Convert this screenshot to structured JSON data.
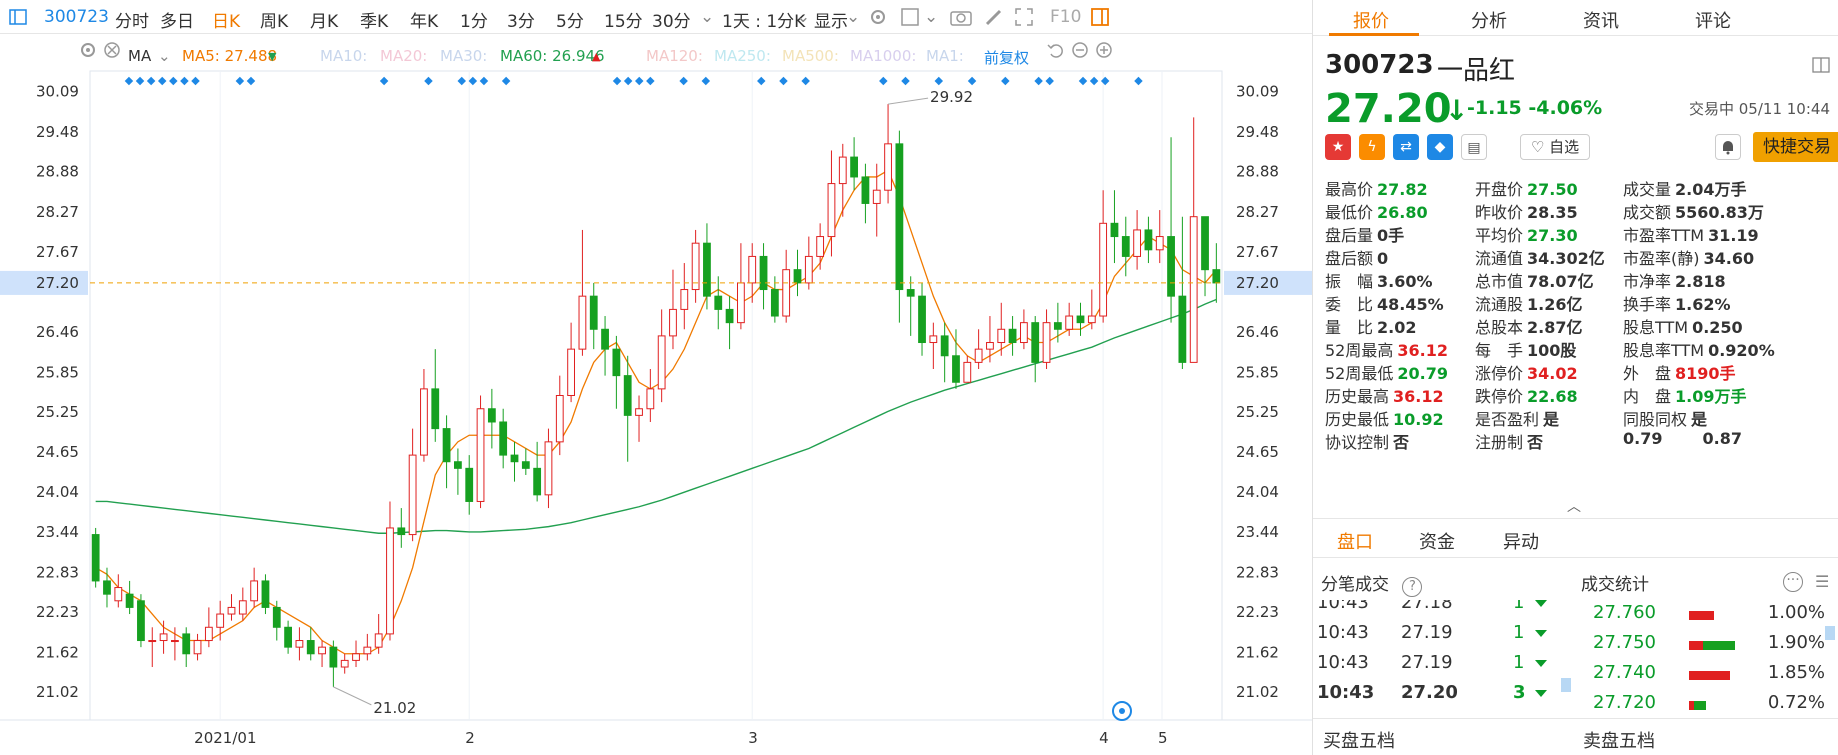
{
  "toolbar": {
    "code": "300723",
    "periods": [
      "分时",
      "多日",
      "日K",
      "周K",
      "月K",
      "季K",
      "年K",
      "1分",
      "3分",
      "5分",
      "15分",
      "30分"
    ],
    "active_period": "日K",
    "interval_select": "1天 : 1分K",
    "display_label": "显示",
    "f10_label": "F10"
  },
  "ma_bar": {
    "type_label": "MA",
    "ma5": "MA5: 27.488",
    "ma10": "MA10:",
    "ma20": "MA20:",
    "ma30": "MA30:",
    "ma60": "MA60: 26.946",
    "ma120": "MA120:",
    "ma250": "MA250:",
    "ma500": "MA500:",
    "ma1000": "MA1000:",
    "ma1": "MA1:",
    "adjust_label": "前复权",
    "colors": {
      "ma5": "#f07a00",
      "ma60": "#22a050",
      "faded": "#c8d6ec"
    }
  },
  "chart_data": {
    "type": "candlestick",
    "y_ticks": [
      "30.09",
      "29.48",
      "28.88",
      "28.27",
      "27.67",
      "27.07",
      "26.46",
      "25.85",
      "25.25",
      "24.65",
      "24.04",
      "23.44",
      "22.83",
      "22.23",
      "21.62",
      "21.02"
    ],
    "ylim": [
      20.6,
      30.4
    ],
    "x_labels": [
      "2021/01",
      "2",
      "3",
      "4",
      "5"
    ],
    "current_price": "27.20",
    "high_label": "29.92",
    "low_label": "21.02",
    "up_color": "#e02020",
    "down_color": "#16a020",
    "candles": [
      [
        23.4,
        22.7,
        23.5,
        22.6
      ],
      [
        22.7,
        22.5,
        22.9,
        22.3
      ],
      [
        22.4,
        22.6,
        22.8,
        22.3
      ],
      [
        22.5,
        22.3,
        22.7,
        22.2
      ],
      [
        22.4,
        21.8,
        22.5,
        21.7
      ],
      [
        21.8,
        21.8,
        22.0,
        21.4
      ],
      [
        21.8,
        21.9,
        22.1,
        21.6
      ],
      [
        21.8,
        21.8,
        22.0,
        21.5
      ],
      [
        21.9,
        21.6,
        22.0,
        21.4
      ],
      [
        21.6,
        21.8,
        21.9,
        21.5
      ],
      [
        21.8,
        22.0,
        22.3,
        21.7
      ],
      [
        22.0,
        22.2,
        22.4,
        21.8
      ],
      [
        22.2,
        22.3,
        22.5,
        22.1
      ],
      [
        22.2,
        22.4,
        22.6,
        22.1
      ],
      [
        22.4,
        22.7,
        22.9,
        22.3
      ],
      [
        22.7,
        22.3,
        22.8,
        22.2
      ],
      [
        22.3,
        22.0,
        22.4,
        21.8
      ],
      [
        22.0,
        21.7,
        22.1,
        21.6
      ],
      [
        21.7,
        21.8,
        22.0,
        21.5
      ],
      [
        21.8,
        21.6,
        22.0,
        21.5
      ],
      [
        21.6,
        21.7,
        21.8,
        21.4
      ],
      [
        21.7,
        21.4,
        21.8,
        21.1
      ],
      [
        21.4,
        21.5,
        21.6,
        21.3
      ],
      [
        21.5,
        21.6,
        21.8,
        21.4
      ],
      [
        21.6,
        21.7,
        21.9,
        21.5
      ],
      [
        21.7,
        21.9,
        22.2,
        21.6
      ],
      [
        21.9,
        23.5,
        23.9,
        21.8
      ],
      [
        23.5,
        23.4,
        23.8,
        23.2
      ],
      [
        23.4,
        24.6,
        25.0,
        23.3
      ],
      [
        24.6,
        25.6,
        25.9,
        24.5
      ],
      [
        25.6,
        25.0,
        26.2,
        24.8
      ],
      [
        25.0,
        24.5,
        25.2,
        24.1
      ],
      [
        24.5,
        24.4,
        24.7,
        24.0
      ],
      [
        24.4,
        23.9,
        24.6,
        23.7
      ],
      [
        23.9,
        25.3,
        25.5,
        23.8
      ],
      [
        25.3,
        25.1,
        25.6,
        24.7
      ],
      [
        25.1,
        24.6,
        25.3,
        24.4
      ],
      [
        24.6,
        24.5,
        24.8,
        24.2
      ],
      [
        24.5,
        24.4,
        24.7,
        24.3
      ],
      [
        24.4,
        24.0,
        24.8,
        23.9
      ],
      [
        24.0,
        24.8,
        25.0,
        23.8
      ],
      [
        24.8,
        25.5,
        25.8,
        24.6
      ],
      [
        25.5,
        26.2,
        26.6,
        25.4
      ],
      [
        26.2,
        27.0,
        28.0,
        26.1
      ],
      [
        27.0,
        26.5,
        27.2,
        26.2
      ],
      [
        26.5,
        26.2,
        26.7,
        25.8
      ],
      [
        26.2,
        25.8,
        26.4,
        25.3
      ],
      [
        25.8,
        25.2,
        26.1,
        24.5
      ],
      [
        25.2,
        25.3,
        25.5,
        24.8
      ],
      [
        25.3,
        25.6,
        25.9,
        25.1
      ],
      [
        25.6,
        26.4,
        26.8,
        25.4
      ],
      [
        26.4,
        26.8,
        27.4,
        26.2
      ],
      [
        26.8,
        27.1,
        27.5,
        26.5
      ],
      [
        27.1,
        27.8,
        28.0,
        26.9
      ],
      [
        27.8,
        27.0,
        28.1,
        26.8
      ],
      [
        27.0,
        26.8,
        27.3,
        26.5
      ],
      [
        26.8,
        26.6,
        27.0,
        26.2
      ],
      [
        26.6,
        27.2,
        27.8,
        26.5
      ],
      [
        27.2,
        27.6,
        27.8,
        26.9
      ],
      [
        27.6,
        27.1,
        27.8,
        26.8
      ],
      [
        27.1,
        26.7,
        27.3,
        26.6
      ],
      [
        26.7,
        27.4,
        27.7,
        26.6
      ],
      [
        27.4,
        27.2,
        27.7,
        27.0
      ],
      [
        27.2,
        27.6,
        27.9,
        27.1
      ],
      [
        27.6,
        27.9,
        28.1,
        27.4
      ],
      [
        27.9,
        28.7,
        29.2,
        27.6
      ],
      [
        28.7,
        29.1,
        29.3,
        28.2
      ],
      [
        29.1,
        28.8,
        29.4,
        28.6
      ],
      [
        28.8,
        28.4,
        29.0,
        28.1
      ],
      [
        28.4,
        28.6,
        29.0,
        27.9
      ],
      [
        28.6,
        29.3,
        29.9,
        28.4
      ],
      [
        29.3,
        27.1,
        29.5,
        26.6
      ],
      [
        27.1,
        27.0,
        27.3,
        26.4
      ],
      [
        27.0,
        26.3,
        27.2,
        26.1
      ],
      [
        26.3,
        26.4,
        26.6,
        25.9
      ],
      [
        26.4,
        26.1,
        26.6,
        25.7
      ],
      [
        26.1,
        25.7,
        26.5,
        25.6
      ],
      [
        25.7,
        26.0,
        26.1,
        25.8
      ],
      [
        26.0,
        26.2,
        26.5,
        25.9
      ],
      [
        26.2,
        26.3,
        26.7,
        26.0
      ],
      [
        26.3,
        26.5,
        26.9,
        26.1
      ],
      [
        26.5,
        26.3,
        26.7,
        26.1
      ],
      [
        26.3,
        26.6,
        26.8,
        26.2
      ],
      [
        26.6,
        26.0,
        26.7,
        25.7
      ],
      [
        26.0,
        26.6,
        26.8,
        25.9
      ],
      [
        26.6,
        26.5,
        26.9,
        26.3
      ],
      [
        26.5,
        26.7,
        26.9,
        26.4
      ],
      [
        26.7,
        26.6,
        26.9,
        26.4
      ],
      [
        26.6,
        26.7,
        27.1,
        26.5
      ],
      [
        26.7,
        28.1,
        28.6,
        26.6
      ],
      [
        28.1,
        27.9,
        28.6,
        27.5
      ],
      [
        27.9,
        27.6,
        28.2,
        27.3
      ],
      [
        27.6,
        28.0,
        28.3,
        27.4
      ],
      [
        28.0,
        27.7,
        28.2,
        27.5
      ],
      [
        27.7,
        27.9,
        28.3,
        27.5
      ],
      [
        27.9,
        27.0,
        29.4,
        26.6
      ],
      [
        27.0,
        26.0,
        28.2,
        25.9
      ],
      [
        26.0,
        28.2,
        29.7,
        26.0
      ],
      [
        28.2,
        27.4,
        27.9,
        27.0
      ],
      [
        27.4,
        27.2,
        27.8,
        26.9
      ]
    ],
    "ma5_line": [
      22.9,
      22.8,
      22.6,
      22.5,
      22.4,
      22.2,
      22.0,
      21.9,
      21.8,
      21.8,
      21.8,
      21.9,
      22.0,
      22.1,
      22.3,
      22.4,
      22.3,
      22.2,
      22.1,
      22.0,
      21.8,
      21.7,
      21.6,
      21.6,
      21.6,
      21.7,
      22.0,
      22.4,
      22.9,
      23.6,
      24.3,
      24.6,
      24.8,
      24.9,
      24.9,
      24.9,
      24.9,
      24.8,
      24.7,
      24.6,
      24.6,
      24.8,
      25.1,
      25.6,
      26.0,
      26.2,
      26.3,
      26.0,
      25.7,
      25.6,
      25.7,
      25.9,
      26.2,
      26.6,
      27.0,
      27.1,
      27.0,
      26.9,
      27.0,
      27.2,
      27.1,
      27.1,
      27.2,
      27.3,
      27.5,
      27.9,
      28.3,
      28.6,
      28.8,
      28.8,
      28.9,
      28.5,
      28.0,
      27.5,
      27.0,
      26.6,
      26.3,
      26.1,
      26.0,
      26.1,
      26.2,
      26.3,
      26.4,
      26.3,
      26.3,
      26.4,
      26.5,
      26.5,
      26.6,
      26.9,
      27.3,
      27.5,
      27.7,
      27.9,
      27.8,
      27.7,
      27.4,
      27.3,
      27.2,
      27.4
    ],
    "ma60_line": [
      23.9,
      23.9,
      23.88,
      23.86,
      23.84,
      23.82,
      23.8,
      23.78,
      23.76,
      23.74,
      23.72,
      23.7,
      23.68,
      23.66,
      23.64,
      23.62,
      23.6,
      23.58,
      23.56,
      23.54,
      23.52,
      23.5,
      23.48,
      23.46,
      23.44,
      23.42,
      23.42,
      23.43,
      23.44,
      23.45,
      23.46,
      23.46,
      23.45,
      23.44,
      23.44,
      23.45,
      23.46,
      23.47,
      23.48,
      23.5,
      23.52,
      23.55,
      23.58,
      23.62,
      23.66,
      23.7,
      23.74,
      23.78,
      23.82,
      23.87,
      23.92,
      23.98,
      24.04,
      24.1,
      24.16,
      24.22,
      24.28,
      24.34,
      24.4,
      24.46,
      24.52,
      24.58,
      24.64,
      24.7,
      24.78,
      24.86,
      24.94,
      25.02,
      25.1,
      25.18,
      25.26,
      25.33,
      25.4,
      25.46,
      25.52,
      25.58,
      25.63,
      25.68,
      25.73,
      25.78,
      25.83,
      25.88,
      25.93,
      25.98,
      26.03,
      26.08,
      26.13,
      26.18,
      26.23,
      26.3,
      26.37,
      26.43,
      26.49,
      26.55,
      26.61,
      26.67,
      26.73,
      26.8,
      26.88,
      26.95
    ]
  },
  "right_panel": {
    "tabs": [
      "报价",
      "分析",
      "资讯",
      "评论"
    ],
    "active_tab": "报价",
    "code": "300723",
    "name": "一品红",
    "price": "27.20",
    "arrow": "↓",
    "change": "-1.15",
    "change_pct": "-4.06%",
    "status_time": "交易中 05/11 10:44",
    "zixuan_label": "自选",
    "quick_trade_label": "快捷交易",
    "quote_rows": [
      [
        {
          "l": "最高价",
          "v": "27.82",
          "c": "green"
        },
        {
          "l": "开盘价",
          "v": "27.50",
          "c": "green"
        },
        {
          "l": "成交量",
          "v": "2.04万手",
          "c": "dark"
        }
      ],
      [
        {
          "l": "最低价",
          "v": "26.80",
          "c": "green"
        },
        {
          "l": "昨收价",
          "v": "28.35",
          "c": "dark"
        },
        {
          "l": "成交额",
          "v": "5560.83万",
          "c": "dark"
        }
      ],
      [
        {
          "l": "盘后量",
          "v": "0手",
          "c": "dark"
        },
        {
          "l": "平均价",
          "v": "27.30",
          "c": "green"
        },
        {
          "l": "市盈率TTM",
          "v": "31.19",
          "c": "dark"
        }
      ],
      [
        {
          "l": "盘后额",
          "v": "0",
          "c": "dark"
        },
        {
          "l": "流通值",
          "v": "34.302亿",
          "c": "dark"
        },
        {
          "l": "市盈率(静)",
          "v": "34.60",
          "c": "dark"
        }
      ],
      [
        {
          "l": "振　幅",
          "v": "3.60%",
          "c": "dark"
        },
        {
          "l": "总市值",
          "v": "78.07亿",
          "c": "dark"
        },
        {
          "l": "市净率",
          "v": "2.818",
          "c": "dark"
        }
      ],
      [
        {
          "l": "委　比",
          "v": "48.45%",
          "c": "dark"
        },
        {
          "l": "流通股",
          "v": "1.26亿",
          "c": "dark"
        },
        {
          "l": "换手率",
          "v": "1.62%",
          "c": "dark"
        }
      ],
      [
        {
          "l": "量　比",
          "v": "2.02",
          "c": "dark"
        },
        {
          "l": "总股本",
          "v": "2.87亿",
          "c": "dark"
        },
        {
          "l": "股息TTM",
          "v": "0.250",
          "c": "dark"
        }
      ],
      [
        {
          "l": "52周最高",
          "v": "36.12",
          "c": "red"
        },
        {
          "l": "每　手",
          "v": "100股",
          "c": "dark"
        },
        {
          "l": "股息率TTM",
          "v": "0.920%",
          "c": "dark"
        }
      ],
      [
        {
          "l": "52周最低",
          "v": "20.79",
          "c": "green"
        },
        {
          "l": "涨停价",
          "v": "34.02",
          "c": "red"
        },
        {
          "l": "外　盘",
          "v": "8190手",
          "c": "red"
        }
      ],
      [
        {
          "l": "历史最高",
          "v": "36.12",
          "c": "red"
        },
        {
          "l": "跌停价",
          "v": "22.68",
          "c": "green"
        },
        {
          "l": "内　盘",
          "v": "1.09万手",
          "c": "green"
        }
      ],
      [
        {
          "l": "历史最低",
          "v": "10.92",
          "c": "green"
        },
        {
          "l": "是否盈利",
          "v": "是",
          "c": "dark"
        },
        {
          "l": "同股同权",
          "v": "是",
          "c": "dark"
        }
      ],
      [
        {
          "l": "协议控制",
          "v": "否",
          "c": "dark"
        },
        {
          "l": "注册制",
          "v": "否",
          "c": "dark"
        },
        {
          "l": "0.79",
          "v": "0.87",
          "c": "dark"
        }
      ]
    ],
    "sub_tabs": [
      "盘口",
      "资金",
      "异动"
    ],
    "active_sub_tab": "盘口",
    "trades_title": "分笔成交",
    "stats_title": "成交统计",
    "trades": [
      {
        "time": "10:43",
        "price": "27.18",
        "vol": "1"
      },
      {
        "time": "10:43",
        "price": "27.19",
        "vol": "1"
      },
      {
        "time": "10:43",
        "price": "27.19",
        "vol": "1"
      },
      {
        "time": "10:43",
        "price": "27.20",
        "vol": "3"
      }
    ],
    "stats": [
      {
        "price": "27.760",
        "pct": "1.00%",
        "red": 0.55,
        "green": 0.0
      },
      {
        "price": "27.750",
        "pct": "1.90%",
        "red": 0.3,
        "green": 0.7
      },
      {
        "price": "27.740",
        "pct": "1.85%",
        "red": 0.9,
        "green": 0.0
      },
      {
        "price": "27.720",
        "pct": "0.72%",
        "red": 0.1,
        "green": 0.25
      }
    ],
    "bottom_tabs": [
      "买盘五档",
      "卖盘五档"
    ]
  }
}
